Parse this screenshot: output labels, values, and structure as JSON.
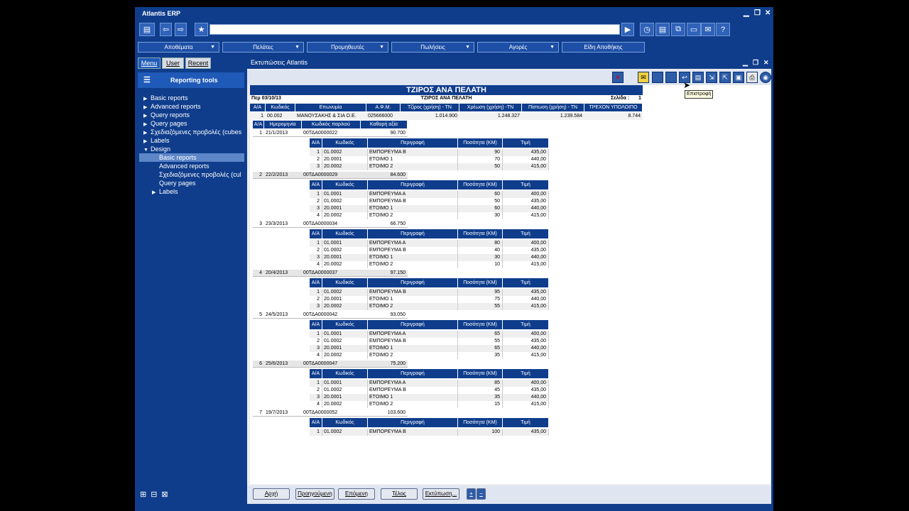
{
  "app": {
    "title": "Atlantis ERP"
  },
  "menus": [
    {
      "label": "Αποθέματα"
    },
    {
      "label": "Πελάτες"
    },
    {
      "label": "Προμηθευτές"
    },
    {
      "label": "Πωλήσεις"
    },
    {
      "label": "Αγορές"
    },
    {
      "label": "Είδη Αποθήκης"
    }
  ],
  "sidebar": {
    "tabs": [
      "Menu",
      "User",
      "Recent"
    ],
    "title": "Reporting tools",
    "tree": [
      {
        "label": "Basic reports",
        "level": 0,
        "toggle": "▶"
      },
      {
        "label": "Advanced reports",
        "level": 0,
        "toggle": "▶"
      },
      {
        "label": "Query reports",
        "level": 0,
        "toggle": "▶"
      },
      {
        "label": "Query pages",
        "level": 0,
        "toggle": "▶"
      },
      {
        "label": "Σχεδιαζόμενες προβολές (cubes",
        "level": 0,
        "toggle": "▶"
      },
      {
        "label": "Labels",
        "level": 0,
        "toggle": "▶"
      },
      {
        "label": "Design",
        "level": 0,
        "toggle": "▼"
      },
      {
        "label": "Basic reports",
        "level": 1,
        "toggle": "",
        "selected": true
      },
      {
        "label": "Advanced reports",
        "level": 1,
        "toggle": ""
      },
      {
        "label": "Σχεδιαζόμενες προβολές (cul",
        "level": 1,
        "toggle": ""
      },
      {
        "label": "Query pages",
        "level": 1,
        "toggle": ""
      },
      {
        "label": "Labels",
        "level": 1,
        "toggle": "▶"
      }
    ]
  },
  "window": {
    "title": "Εκτυπώσεις Atlantis",
    "tooltip": "Επιστροφή"
  },
  "report": {
    "title": "ΤΖΙΡΟΣ ΑΝΑ ΠΕΛΑΤΗ",
    "subtitle": "ΤΖΙΡΟΣ ΑΝΑ ΠΕΛΑΤΗ",
    "date": "Πεμ 03/10/13",
    "page_label": "Σελίδα :",
    "page": "1",
    "cust_headers": [
      "Α/Α",
      "Κωδικός",
      "Επωνυμία",
      "Α.Φ.Μ.",
      "Τζίρος (χρήση) - ΤΝ",
      "Χρέωση (χρήση) -ΤΝ",
      "Πίστωση (χρήση) - ΤΝ",
      "ΤΡΕΧΟΝ ΥΠΟΛΟΙΠΟ"
    ],
    "customer": [
      "1",
      "00.002",
      "ΜΑΝΟΥΣΑΚΗΣ & ΣΙΑ Ο.Ε.",
      "025666000",
      "1.014.900",
      "1.248.327",
      "1.239.584",
      "8.744"
    ],
    "inv_headers": [
      "Α/Α",
      "Ημερομηνία",
      "Κωδικός παρ/κού",
      "Καθαρή αξία"
    ],
    "line_headers": [
      "Α/Α",
      "Κωδικός",
      "Περιγραφή",
      "Ποσότητα (ΚΜ)",
      "Τιμή"
    ],
    "invoices": [
      {
        "aa": "1",
        "date": "21/1/2013",
        "code": "00ΤΔΑ0000022",
        "net": "90.700",
        "lines": [
          [
            "1",
            "01.0002",
            "ΕΜΠΟΡΕΥΜΑ Β",
            "90",
            "435,00"
          ],
          [
            "2",
            "20.0001",
            "ΕΤΟΙΜΟ 1",
            "70",
            "440,00"
          ],
          [
            "3",
            "20.0002",
            "ΕΤΟΙΜΟ 2",
            "50",
            "415,00"
          ]
        ]
      },
      {
        "aa": "2",
        "date": "22/2/2013",
        "code": "00ΤΔΑ0000029",
        "net": "84.600",
        "lines": [
          [
            "1",
            "01.0001",
            "ΕΜΠΟΡΕΥΜΑ Α",
            "60",
            "400,00"
          ],
          [
            "2",
            "01.0002",
            "ΕΜΠΟΡΕΥΜΑ Β",
            "50",
            "435,00"
          ],
          [
            "3",
            "20.0001",
            "ΕΤΟΙΜΟ 1",
            "60",
            "440,00"
          ],
          [
            "4",
            "20.0002",
            "ΕΤΟΙΜΟ 2",
            "30",
            "415,00"
          ]
        ]
      },
      {
        "aa": "3",
        "date": "23/3/2013",
        "code": "00ΤΔΑ0000034",
        "net": "66.750",
        "lines": [
          [
            "1",
            "01.0001",
            "ΕΜΠΟΡΕΥΜΑ Α",
            "80",
            "400,00"
          ],
          [
            "2",
            "01.0002",
            "ΕΜΠΟΡΕΥΜΑ Β",
            "40",
            "435,00"
          ],
          [
            "3",
            "20.0001",
            "ΕΤΟΙΜΟ 1",
            "30",
            "440,00"
          ],
          [
            "4",
            "20.0002",
            "ΕΤΟΙΜΟ 2",
            "10",
            "415,00"
          ]
        ]
      },
      {
        "aa": "4",
        "date": "20/4/2013",
        "code": "00ΤΔΑ0000037",
        "net": "97.150",
        "lines": [
          [
            "1",
            "01.0002",
            "ΕΜΠΟΡΕΥΜΑ Β",
            "95",
            "435,00"
          ],
          [
            "2",
            "20.0001",
            "ΕΤΟΙΜΟ 1",
            "75",
            "440,00"
          ],
          [
            "3",
            "20.0002",
            "ΕΤΟΙΜΟ 2",
            "55",
            "415,00"
          ]
        ]
      },
      {
        "aa": "5",
        "date": "24/5/2013",
        "code": "00ΤΔΑ0000042",
        "net": "93.050",
        "lines": [
          [
            "1",
            "01.0001",
            "ΕΜΠΟΡΕΥΜΑ Α",
            "65",
            "400,00"
          ],
          [
            "2",
            "01.0002",
            "ΕΜΠΟΡΕΥΜΑ Β",
            "55",
            "435,00"
          ],
          [
            "3",
            "20.0001",
            "ΕΤΟΙΜΟ 1",
            "65",
            "440,00"
          ],
          [
            "4",
            "20.0002",
            "ΕΤΟΙΜΟ 2",
            "35",
            "415,00"
          ]
        ]
      },
      {
        "aa": "6",
        "date": "25/6/2013",
        "code": "00ΤΔΑ0000047",
        "net": "75.200",
        "lines": [
          [
            "1",
            "01.0001",
            "ΕΜΠΟΡΕΥΜΑ Α",
            "85",
            "400,00"
          ],
          [
            "2",
            "01.0002",
            "ΕΜΠΟΡΕΥΜΑ Β",
            "45",
            "435,00"
          ],
          [
            "3",
            "20.0001",
            "ΕΤΟΙΜΟ 1",
            "35",
            "440,00"
          ],
          [
            "4",
            "20.0002",
            "ΕΤΟΙΜΟ 2",
            "15",
            "415,00"
          ]
        ]
      },
      {
        "aa": "7",
        "date": "19/7/2013",
        "code": "00ΤΔΑ0000052",
        "net": "103.600",
        "lines": [
          [
            "1",
            "01.0002",
            "ΕΜΠΟΡΕΥΜΑ Β",
            "100",
            "435,00"
          ]
        ]
      }
    ]
  },
  "nav": {
    "first": "Αρχή",
    "prev": "Προηγούμενη",
    "next": "Επόμενη",
    "last": "Τέλος",
    "print": "Εκτύπωση..."
  }
}
